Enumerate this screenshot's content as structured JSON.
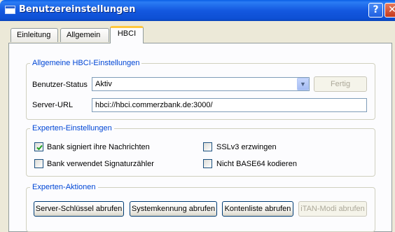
{
  "window": {
    "title": "Benutzereinstellungen",
    "help_glyph": "?",
    "close_glyph": "✕"
  },
  "tabs": [
    {
      "label": "Einleitung"
    },
    {
      "label": "Allgemein"
    },
    {
      "label": "HBCI",
      "active": true
    }
  ],
  "hbci_group": {
    "legend": "Allgemeine HBCI-Einstellungen",
    "status_label": "Benutzer-Status",
    "status_value": "Aktiv",
    "fertig_button": "Fertig",
    "server_label": "Server-URL",
    "server_value": "hbci://hbci.commerzbank.de:3000/"
  },
  "expert_settings": {
    "legend": "Experten-Einstellungen",
    "checkboxes": [
      {
        "label": "Bank signiert ihre Nachrichten",
        "checked": true
      },
      {
        "label": "Bank verwendet Signaturzähler",
        "checked": false
      },
      {
        "label": "SSLv3 erzwingen",
        "checked": false
      },
      {
        "label": "Nicht BASE64 kodieren",
        "checked": false
      }
    ]
  },
  "expert_actions": {
    "legend": "Experten-Aktionen",
    "buttons": [
      {
        "label": "Server-Schlüssel abrufen",
        "enabled": true
      },
      {
        "label": "Systemkennung abrufen",
        "enabled": true
      },
      {
        "label": "Kontenliste abrufen",
        "enabled": true
      },
      {
        "label": "iTAN-Modi abrufen",
        "enabled": false
      }
    ]
  },
  "colors": {
    "titlebar": "#0d4fd4",
    "legend_text": "#0046d5",
    "tab_highlight": "#ffc83c",
    "disabled_text": "#aca899"
  }
}
